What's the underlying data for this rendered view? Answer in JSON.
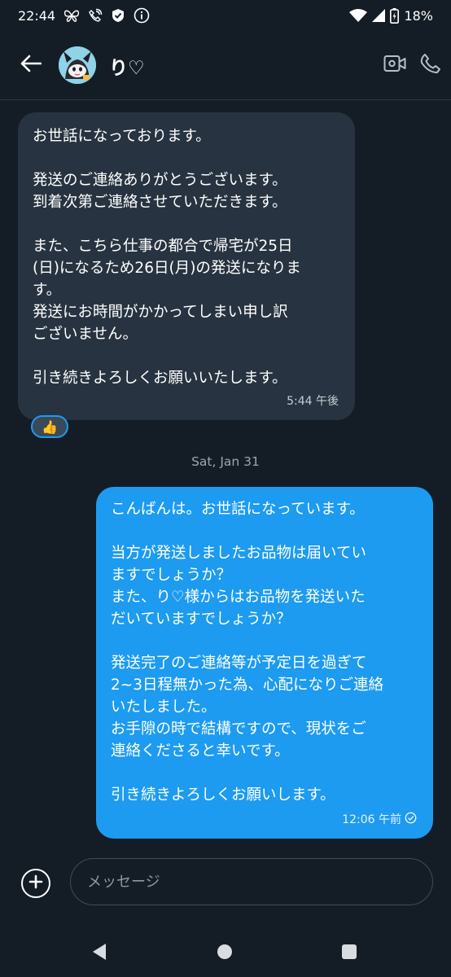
{
  "status_bar": {
    "time": "22:44",
    "battery": "18%",
    "icons": [
      "butterfly-icon",
      "wifi-calling-icon",
      "shield-check-icon",
      "info-icon",
      "wifi-icon",
      "cellular-signal-icon",
      "battery-charging-icon"
    ]
  },
  "header": {
    "contact_name": "り♡",
    "icons": [
      "back-arrow-icon",
      "video-call-icon",
      "phone-call-icon"
    ]
  },
  "messages": [
    {
      "direction": "incoming",
      "text": "お世話になっております。\n\n発送のご連絡ありがとうございます。\n到着次第ご連絡させていただきます。\n\nまた、こちら仕事の都合で帰宅が25日\n(日)になるため26日(月)の発送になりま\nす。\n発送にお時間がかかってしまい申し訳\nございません。\n\n引き続きよろしくお願いいたします。",
      "time": "5:44 午後",
      "reaction": "👍"
    },
    {
      "direction": "outgoing",
      "text": "こんばんは。お世話になっています。\n\n当方が発送しましたお品物は届いてい\nますでしょうか？\nまた、り♡様からはお品物を発送いた\nだいていますでしょうか？\n\n発送完了のご連絡等が予定日を過ぎて\n2~3日程無かった為、心配になりご連絡\nいたしました。\nお手隙の時で結構ですので、現状をご\n連絡くださると幸いです。\n\n引き続きよろしくお願いします。",
      "time": "12:06 午前",
      "status_icon": "read-check-icon"
    }
  ],
  "date_separator": "Sat, Jan 31",
  "composer": {
    "placeholder": "メッセージ",
    "value": ""
  },
  "colors": {
    "background": "#141d26",
    "incoming_bubble": "#273340",
    "outgoing_bubble": "#1d9bf0"
  }
}
